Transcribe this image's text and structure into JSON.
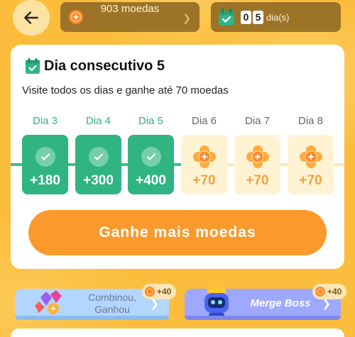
{
  "header": {
    "coins_text": "903 moedas",
    "streak_digits": [
      "0",
      "5"
    ],
    "streak_unit": "dia(s)"
  },
  "checkin": {
    "title": "Dia consecutivo 5",
    "subtitle": "Visite todos os dias e ganhe até 70 moedas",
    "days": [
      {
        "label": "Dia 3",
        "amount": "+180",
        "done": true
      },
      {
        "label": "Dia 4",
        "amount": "+300",
        "done": true
      },
      {
        "label": "Dia 5",
        "amount": "+400",
        "done": true
      },
      {
        "label": "Dia 6",
        "amount": "+70",
        "done": false
      },
      {
        "label": "Dia 7",
        "amount": "+70",
        "done": false
      },
      {
        "label": "Dia 8",
        "amount": "+70",
        "done": false
      }
    ],
    "cta_label": "Ganhe mais moedas"
  },
  "games": [
    {
      "name": "Combinou, Ganhou",
      "bonus": "+40"
    },
    {
      "name": "Merge Boss",
      "bonus": "+40"
    }
  ],
  "colors": {
    "background": "#fbbd3b",
    "done_green": "#2fb482",
    "cta_orange": "#fa9a2c",
    "pending_bg": "#fff3d4"
  }
}
